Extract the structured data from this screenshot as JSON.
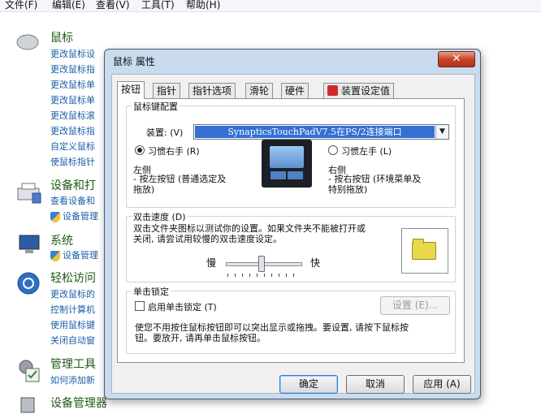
{
  "menubar": {
    "file": "文件(F)",
    "edit": "编辑(E)",
    "view": "查看(V)",
    "tools": "工具(T)",
    "help": "帮助(H)"
  },
  "control_panel": {
    "mouse_title": "鼠标",
    "mouse_links": [
      "更改鼠标设",
      "更改鼠标指",
      "更改鼠标单",
      "更改鼠标单",
      "更改鼠标滚",
      "更改鼠标指",
      "自定义鼠标",
      "使鼠标指针"
    ],
    "devices_title": "设备和打",
    "devices_links": [
      "查看设备和",
      "设备管理"
    ],
    "system_title": "系统",
    "system_links": [
      "设备管理"
    ],
    "ease_title": "轻松访问",
    "ease_links": [
      "更改鼠标的",
      "控制计算机",
      "使用鼠标键",
      "关闭自动窗"
    ],
    "admin_title": "管理工具",
    "admin_links": [
      "如何添加新"
    ],
    "devmgr_title": "设备管理器"
  },
  "dialog": {
    "title": "鼠标 属性",
    "close": "✕",
    "tabs": [
      "按钮",
      "指针",
      "指针选项",
      "滑轮",
      "硬件",
      "装置设定值"
    ],
    "button_config": {
      "group_label": "鼠标键配置",
      "device_label": "装置: (V)",
      "device_value": "SynapticsTouchPadV7.5在PS/2连接端口",
      "right_hand": "习惯右手 (R)",
      "left_hand": "习惯左手 (L)",
      "left_title": "左侧",
      "left_desc": "- 按左按钮 (普通选定及\n拖放)",
      "right_title": "右侧",
      "right_desc": "- 按右按钮 (环境菜单及\n特别拖放)"
    },
    "double_click": {
      "group_label": "双击速度 (D)",
      "desc": "双击文件夹图标以测试你的设置。如果文件夹不能被打开或\n关闭, 请尝试用较慢的双击速度设定。",
      "slow": "慢",
      "fast": "快",
      "speed_value": 0.47
    },
    "click_lock": {
      "group_label": "单击锁定",
      "enable": "启用单击锁定 (T)",
      "settings": "设置 (E)...",
      "desc": "使您不用按住鼠标按钮即可以突出显示或拖拽。要设置, 请按下鼠标按\n钮。要放开, 请再单击鼠标按钮。"
    },
    "buttons": {
      "ok": "确定",
      "cancel": "取消",
      "apply": "应用 (A)"
    }
  }
}
